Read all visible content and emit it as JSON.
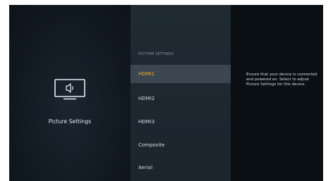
{
  "left_panel": {
    "icon": "tv-speaker-icon",
    "title": "Picture Settings"
  },
  "menu": {
    "section_label": "PICTURE SETTINGS",
    "items": [
      {
        "label": "HDMI1",
        "selected": true
      },
      {
        "label": "HDMI2",
        "selected": false
      },
      {
        "label": "HDMI3",
        "selected": false
      },
      {
        "label": "Composite",
        "selected": false
      },
      {
        "label": "Aerial",
        "selected": false
      }
    ]
  },
  "description": {
    "text": "Ensure that your device is connected and powered on. Select to adjust Picture Settings for this device."
  },
  "colors": {
    "selected_text": "#f2a93b",
    "selected_background": "#3b4650",
    "menu_background": "#1f2a33"
  }
}
